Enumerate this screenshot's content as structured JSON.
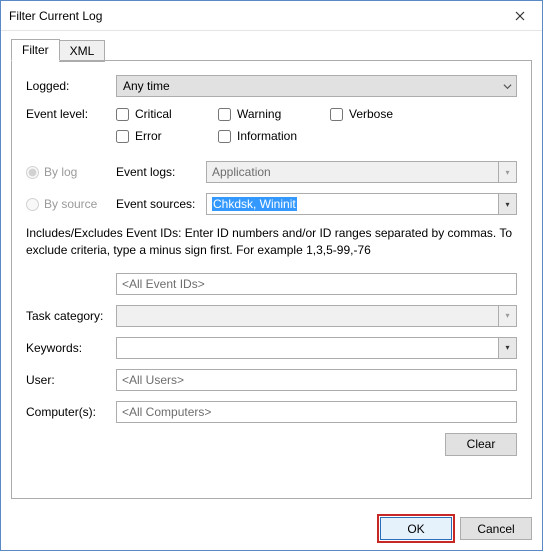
{
  "window": {
    "title": "Filter Current Log"
  },
  "tabs": {
    "filter": "Filter",
    "xml": "XML"
  },
  "labels": {
    "logged": "Logged:",
    "event_level": "Event level:",
    "by_log": "By log",
    "by_source": "By source",
    "event_logs": "Event logs:",
    "event_sources": "Event sources:",
    "task_category": "Task category:",
    "keywords": "Keywords:",
    "user": "User:",
    "computers": "Computer(s):"
  },
  "logged_combo": {
    "value": "Any time"
  },
  "levels": {
    "critical": "Critical",
    "warning": "Warning",
    "verbose": "Verbose",
    "error": "Error",
    "information": "Information"
  },
  "event_logs": {
    "value": "Application"
  },
  "event_sources": {
    "value": "Chkdsk, Wininit"
  },
  "description": "Includes/Excludes Event IDs: Enter ID numbers and/or ID ranges separated by commas. To exclude criteria, type a minus sign first. For example 1,3,5-99,-76",
  "event_ids": {
    "value": "<All Event IDs>"
  },
  "task_category": {
    "value": ""
  },
  "keywords": {
    "value": ""
  },
  "user": {
    "value": "<All Users>"
  },
  "computers": {
    "value": "<All Computers>"
  },
  "buttons": {
    "clear": "Clear",
    "ok": "OK",
    "cancel": "Cancel"
  }
}
